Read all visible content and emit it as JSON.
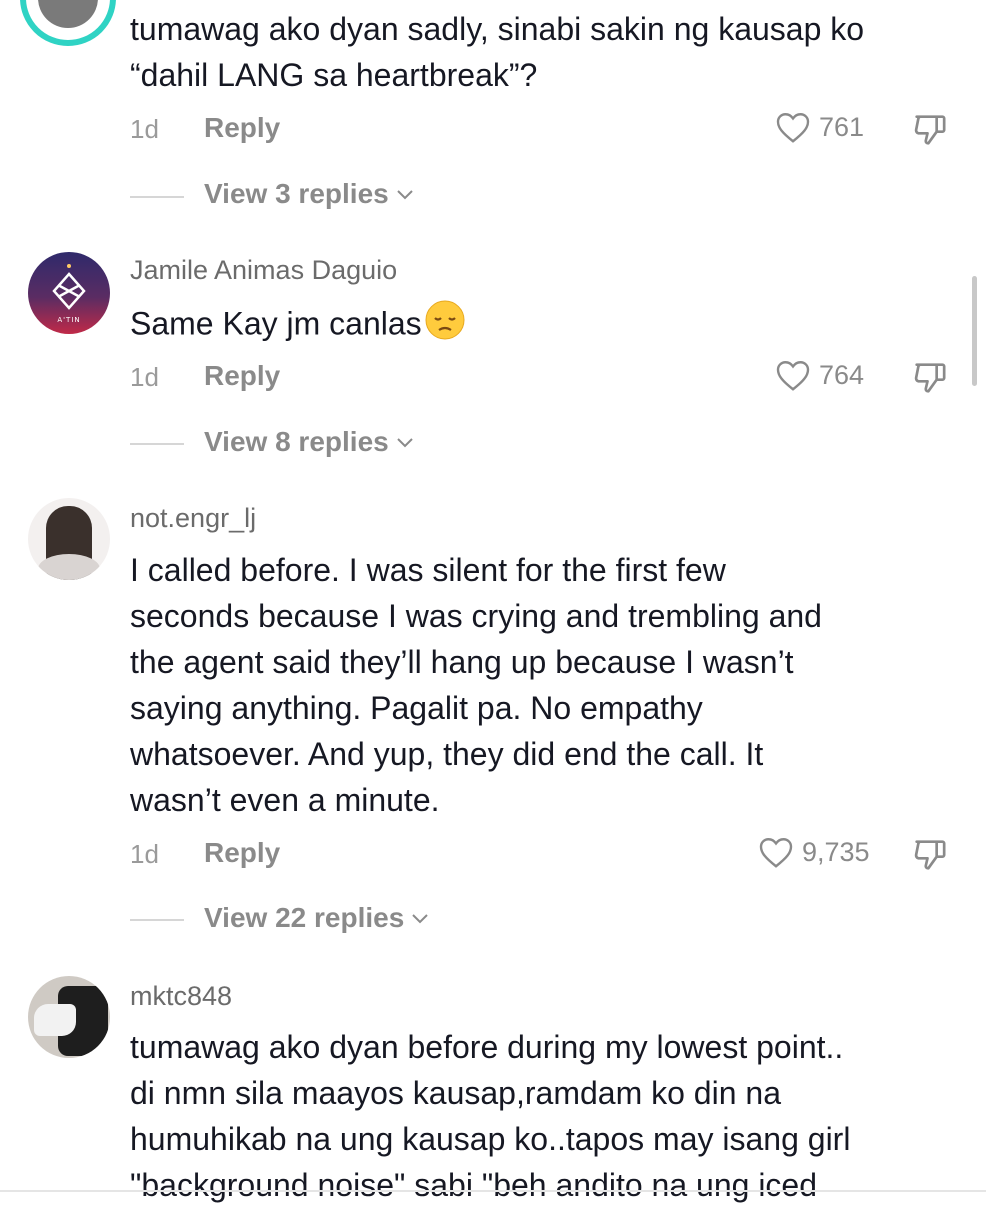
{
  "comments": [
    {
      "username": "",
      "lines": [
        "tumawag ako dyan sadly, sinabi sakin ng kausap ko",
        "“dahil LANG sa heartbreak”?"
      ],
      "time": "1d",
      "reply_label": "Reply",
      "likes": "761",
      "view_replies": "View 3 replies"
    },
    {
      "username": "Jamile Animas Daguio",
      "avatar_text": "A'TIN",
      "lines": [
        "Same Kay jm canlas"
      ],
      "emoji": "disappointed-face",
      "time": "1d",
      "reply_label": "Reply",
      "likes": "764",
      "view_replies": "View 8 replies"
    },
    {
      "username": "not.engr_lj",
      "lines": [
        "I called before. I was silent for the first few",
        "seconds because I was crying and trembling and",
        "the agent said they’ll hang up because I wasn’t",
        "saying anything. Pagalit pa. No empathy",
        "whatsoever. And yup, they did end the call. It",
        "wasn’t even a minute."
      ],
      "time": "1d",
      "reply_label": "Reply",
      "likes": "9,735",
      "view_replies": "View 22 replies"
    },
    {
      "username": "mktc848",
      "lines": [
        "tumawag ako dyan before during my lowest point..",
        "di nmn sila maayos kausap,ramdam ko din na",
        "humuhikab na ung kausap ko..tapos may isang girl",
        "\"background noise\" sabi \"beh andito na ung iced"
      ]
    }
  ],
  "colors": {
    "text": "#161823",
    "muted": "#8a8a8a",
    "teal_ring": "#2fd3c4",
    "avatar2_bg": "#3b2b67",
    "avatar2_accent": "#e0314b"
  }
}
